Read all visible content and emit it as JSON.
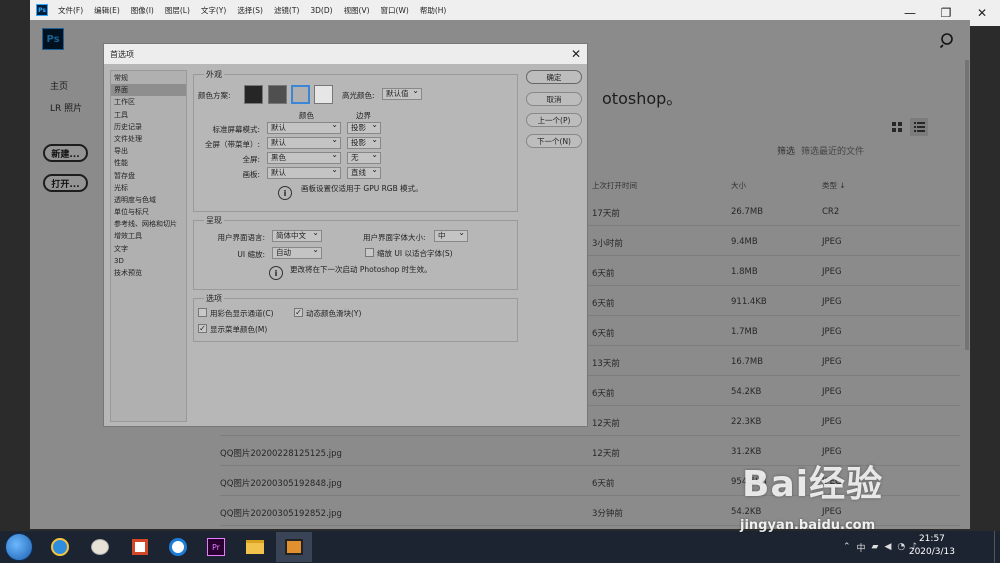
{
  "menubar": {
    "ps_mini": "Ps",
    "items": [
      "文件(F)",
      "编辑(E)",
      "图像(I)",
      "图层(L)",
      "文字(Y)",
      "选择(S)",
      "滤镜(T)",
      "3D(D)",
      "视图(V)",
      "窗口(W)",
      "帮助(H)"
    ]
  },
  "window_controls": {
    "minimize": "—",
    "restore": "❐",
    "close": "✕"
  },
  "home": {
    "logo": "Ps",
    "sidebar": {
      "home": "主页",
      "lr": "LR 照片",
      "new_button": "新建...",
      "open_button": "打开..."
    },
    "welcome_tail": "otoshop。",
    "filter_label": "筛选",
    "filter_placeholder": "筛选最近的文件",
    "columns": {
      "opened": "上次打开时间",
      "size": "大小",
      "type": "类型"
    },
    "sort_arrow": "↓",
    "files": [
      {
        "name": "",
        "opened": "17天前",
        "size": "26.7MB",
        "type": "CR2"
      },
      {
        "name": "",
        "opened": "3小时前",
        "size": "9.4MB",
        "type": "JPEG"
      },
      {
        "name": "",
        "opened": "6天前",
        "size": "1.8MB",
        "type": "JPEG"
      },
      {
        "name": "",
        "opened": "6天前",
        "size": "911.4KB",
        "type": "JPEG"
      },
      {
        "name": "",
        "opened": "6天前",
        "size": "1.7MB",
        "type": "JPEG"
      },
      {
        "name": "",
        "opened": "13天前",
        "size": "16.7MB",
        "type": "JPEG"
      },
      {
        "name": "",
        "opened": "6天前",
        "size": "54.2KB",
        "type": "JPEG"
      },
      {
        "name": "",
        "opened": "12天前",
        "size": "22.3KB",
        "type": "JPEG"
      },
      {
        "name": "QQ图片20200228125125.jpg",
        "opened": "12天前",
        "size": "31.2KB",
        "type": "JPEG"
      },
      {
        "name": "QQ图片20200305192848.jpg",
        "opened": "6天前",
        "size": "954.5KB",
        "type": "JPEG"
      },
      {
        "name": "QQ图片20200305192852.jpg",
        "opened": "3分钟前",
        "size": "54.2KB",
        "type": "JPEG"
      }
    ]
  },
  "dialog": {
    "title": "首选项",
    "close": "✕",
    "categories": [
      "常规",
      "界面",
      "工作区",
      "工具",
      "历史记录",
      "文件处理",
      "导出",
      "性能",
      "暂存盘",
      "光标",
      "透明度与色域",
      "单位与标尺",
      "参考线、网格和切片",
      "增效工具",
      "文字",
      "3D",
      "技术预览"
    ],
    "selected_category": "界面",
    "appearance": {
      "group": "外观",
      "color_scheme_label": "颜色方案:",
      "highlight_label": "高光颜色:",
      "highlight_value": "默认值",
      "col_color": "颜色",
      "col_border": "边界",
      "rows": [
        {
          "label": "标准屏幕模式:",
          "color": "默认",
          "border": "投影"
        },
        {
          "label": "全屏（带菜单）:",
          "color": "默认",
          "border": "投影"
        },
        {
          "label": "全屏:",
          "color": "黑色",
          "border": "无"
        },
        {
          "label": "画板:",
          "color": "默认",
          "border": "直线"
        }
      ],
      "note": "画板设置仅适用于 GPU RGB 模式。",
      "swatch_colors": [
        "#262626",
        "#4f4f4f",
        "#b0b0b0",
        "#e6e6e6"
      ]
    },
    "presentation": {
      "group": "呈现",
      "language_label": "用户界面语言:",
      "language_value": "简体中文",
      "font_size_label": "用户界面字体大小:",
      "font_size_value": "中",
      "scale_label": "UI 缩放:",
      "scale_value": "自动",
      "scale_fonts_label": "缩放 UI 以适合字体(S)",
      "note": "更改将在下一次启动 Photoshop 时生效。"
    },
    "options": {
      "group": "选项",
      "color_channels": "用彩色显示通道(C)",
      "dynamic_sliders": "动态颜色滑块(Y)",
      "menu_colors": "显示菜单颜色(M)",
      "check_mark": "✓"
    },
    "buttons": {
      "ok": "确定",
      "cancel": "取消",
      "prev": "上一个(P)",
      "next": "下一个(N)"
    }
  },
  "taskbar": {
    "pr_label": "Pr",
    "clock_time": "21:57",
    "clock_date": "2020/3/13",
    "ime": "中"
  },
  "watermark": {
    "brand": "Bai经验",
    "url": "jingyan.baidu.com"
  }
}
